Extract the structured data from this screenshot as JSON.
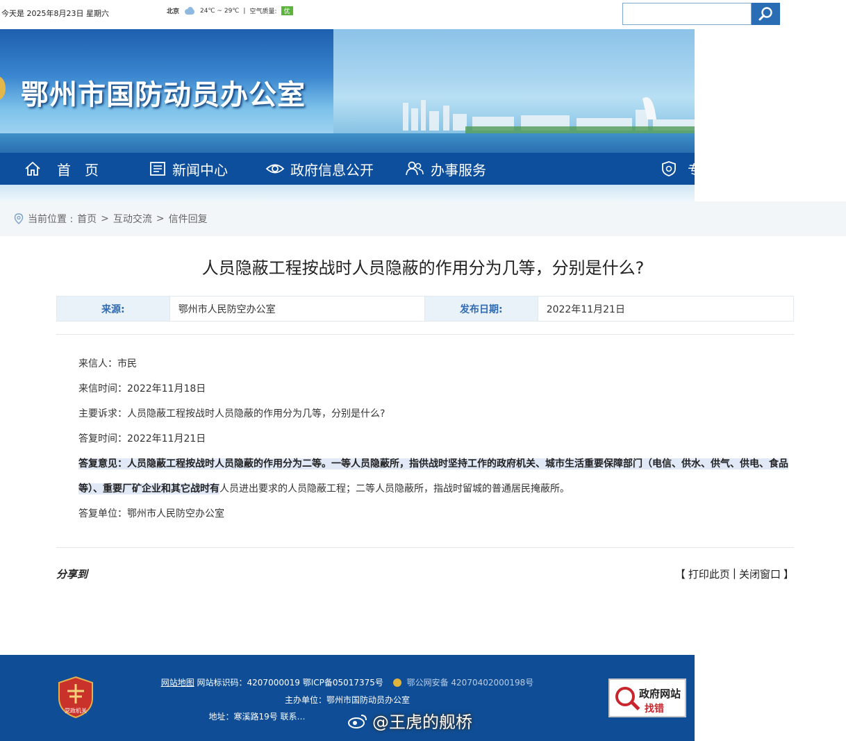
{
  "topbar": {
    "date": "今天是 2025年8月23日 星期六",
    "city": "北京",
    "temp": "24℃ ~ 29℃",
    "separator": "|",
    "aq_label": "空气质量:",
    "aq_value": "优"
  },
  "banner": {
    "title": "鄂州市国防动员办公室"
  },
  "nav": {
    "items": [
      {
        "label": "首　页",
        "icon": "home-icon"
      },
      {
        "label": "新闻中心",
        "icon": "news-icon"
      },
      {
        "label": "政府信息公开",
        "icon": "eye-icon"
      },
      {
        "label": "办事服务",
        "icon": "users-icon"
      },
      {
        "label": "专",
        "icon": "shield-icon"
      }
    ]
  },
  "breadcrumb": {
    "prefix": "当前位置 :",
    "items": [
      "首页",
      "互动交流",
      "信件回复"
    ],
    "separator": ">"
  },
  "article": {
    "title": "人员隐蔽工程按战时人员隐蔽的作用分为几等，分别是什么?",
    "source_label": "来源:",
    "source": "鄂州市人民防空办公室",
    "date_label": "发布日期:",
    "date": "2022年11月21日",
    "sender": "来信人：市民",
    "sent_time": "来信时间：2022年11月18日",
    "question": "主要诉求：人员隐蔽工程按战时人员隐蔽的作用分为几等，分别是什么?",
    "reply_time": "答复时间：2022年11月21日",
    "reply_highlight": "答复意见：人员隐蔽工程按战时人员隐蔽的作用分为二等。一等人员隐蔽所，指供战时坚持工作的政府机关、城市生活重要保障部门（电信、供水、供气、供电、食品等）、重要厂矿企业和其它战时有",
    "reply_rest": "人员进出要求的人员隐蔽工程；二等人员隐蔽所，指战时留城的普通居民掩蔽所。",
    "reply_unit": "答复单位：鄂州市人民防空办公室"
  },
  "share_label": "分享到",
  "actions": {
    "open": "【",
    "print": "打印此页",
    "divider": "|",
    "close_window": "关闭窗口",
    "end": "】"
  },
  "footer": {
    "sitemap": "网站地图",
    "site_code": "网站标识码：4207000019 鄂ICP备05017375号",
    "police": "鄂公网安备 42070402000198号",
    "host": "主办单位：鄂州市国防动员办公室",
    "address": "地址：寒溪路19号 联系…",
    "logo_text": "党政机关",
    "error_title": "政府网站",
    "error_action": "找错"
  },
  "watermark": "@王虎的舰桥",
  "colors": {
    "nav_bg": "#0d4f9c",
    "footer_bg": "#0f4e96",
    "label_blue": "#2f6bb2",
    "highlight": "#e2e9f6"
  }
}
